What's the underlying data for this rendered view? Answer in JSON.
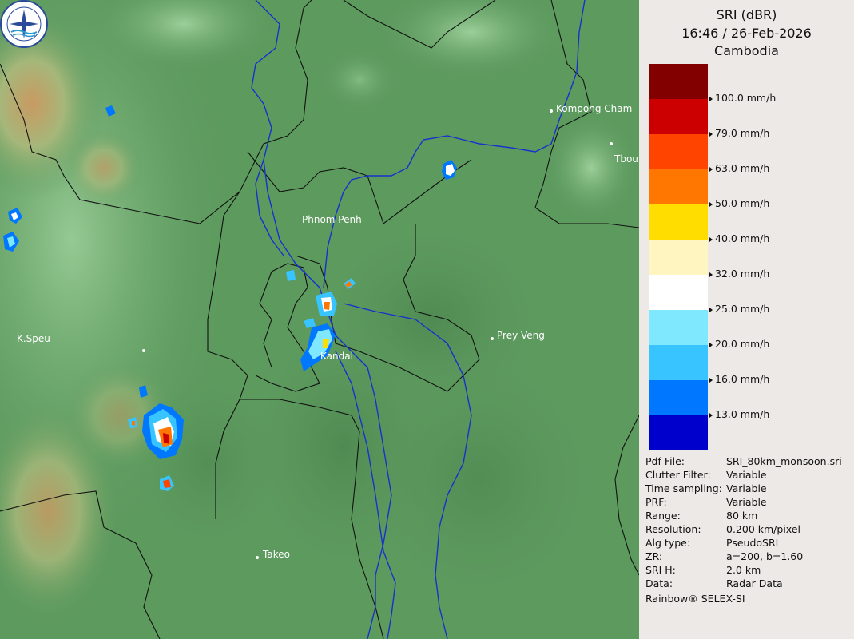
{
  "header": {
    "product": "SRI (dBR)",
    "datetime": "16:46 / 26-Feb-2026",
    "region": "Cambodia"
  },
  "legend": {
    "items": [
      {
        "color": "#820000",
        "label": ""
      },
      {
        "color": "#cc0000",
        "label": "100.0 mm/h"
      },
      {
        "color": "#ff4400",
        "label": "79.0 mm/h"
      },
      {
        "color": "#ff7700",
        "label": "63.0 mm/h"
      },
      {
        "color": "#ffdd00",
        "label": "50.0 mm/h"
      },
      {
        "color": "#fff5c0",
        "label": "40.0 mm/h"
      },
      {
        "color": "#ffffff",
        "label": "32.0 mm/h"
      },
      {
        "color": "#7fe8ff",
        "label": "25.0 mm/h"
      },
      {
        "color": "#38c4ff",
        "label": "20.0 mm/h"
      },
      {
        "color": "#0077ff",
        "label": "16.0 mm/h"
      },
      {
        "color": "#0000cc",
        "label": "13.0 mm/h"
      }
    ]
  },
  "metadata": [
    {
      "key": "Pdf File:",
      "value": "SRI_80km_monsoon.sri"
    },
    {
      "key": "Clutter Filter:",
      "value": "Variable"
    },
    {
      "key": "Time sampling:",
      "value": "Variable"
    },
    {
      "key": "PRF:",
      "value": "Variable"
    },
    {
      "key": "Range:",
      "value": "80 km"
    },
    {
      "key": "Resolution:",
      "value": "0.200 km/pixel"
    },
    {
      "key": "Alg type:",
      "value": "PseudoSRI"
    },
    {
      "key": "ZR:",
      "value": "a=200, b=1.60"
    },
    {
      "key": "SRI H:",
      "value": "2.0 km"
    },
    {
      "key": "Data:",
      "value": "Radar Data"
    }
  ],
  "footer": "Rainbow® SELEX-SI",
  "cities": [
    {
      "name": "Kompong Cham"
    },
    {
      "name": "Tbou"
    },
    {
      "name": "Phnom Penh"
    },
    {
      "name": "Prey Veng"
    },
    {
      "name": "K.Speu"
    },
    {
      "name": "Kandal"
    },
    {
      "name": "Takeo"
    }
  ],
  "colors": {
    "terrain_base": "#5d9a5e",
    "river": "#1533cc",
    "border": "#111111",
    "panel_bg": "#ece9e6"
  }
}
